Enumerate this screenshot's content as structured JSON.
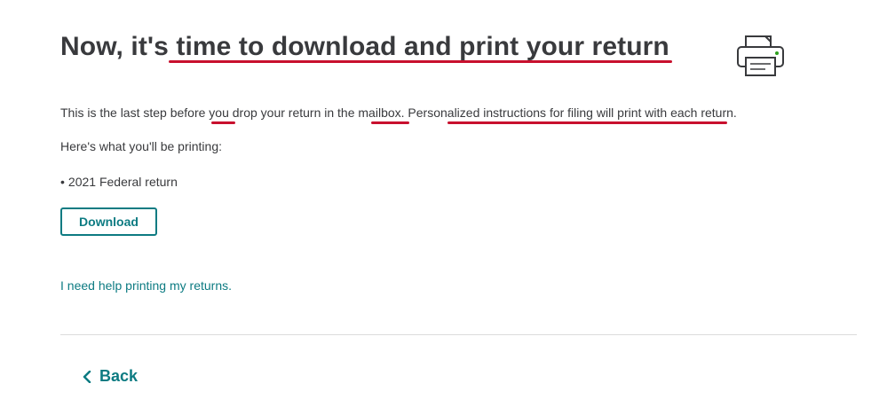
{
  "page": {
    "title": "Now, it's time to download and print your return",
    "intro": "This is the last step before you drop your return in the mailbox. Personalized instructions for filing will print with each return.",
    "printing_heading": "Here's what you'll be printing:",
    "print_items": [
      "2021 Federal return"
    ],
    "download_label": "Download",
    "help_link": "I need help printing my returns.",
    "back_label": "Back"
  },
  "icons": {
    "printer": "printer-icon",
    "back": "chevron-left-icon"
  },
  "colors": {
    "accent": "#0d7b82",
    "text": "#393a3d",
    "annotation": "#c8102e",
    "divider": "#dcdcdc",
    "printer_led": "#2ca01c"
  }
}
